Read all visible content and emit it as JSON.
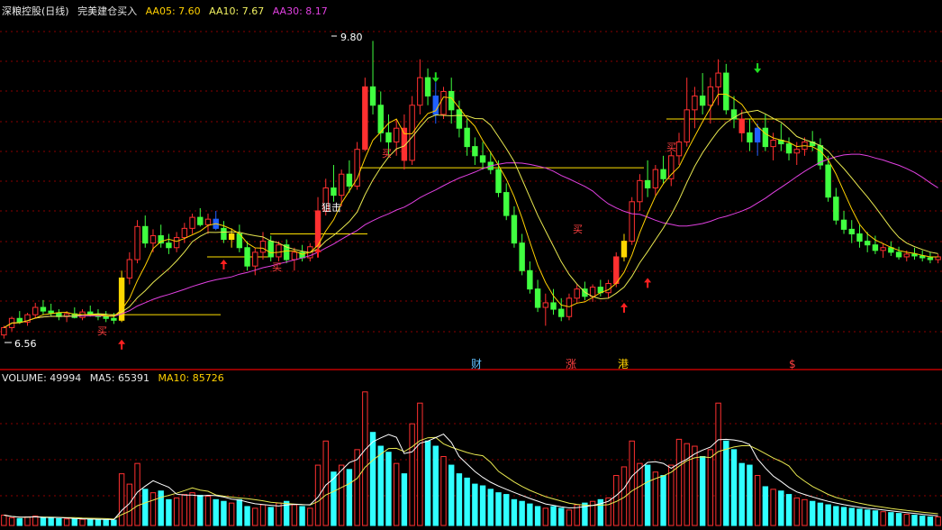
{
  "header": {
    "stock_name": "深粮控股(日线)",
    "indicator_name": "完美建仓买入",
    "aa05_label": "AA05: 7.60",
    "aa10_label": "AA10: 7.67",
    "aa30_label": "AA30: 8.17"
  },
  "volume_header": {
    "volume_label": "VOLUME: 49994",
    "ma5_label": "MA5: 65391",
    "ma10_label": "MA10: 85726"
  },
  "colors": {
    "up": "#ff3030",
    "down": "#30ffff",
    "down_candle": "#40ff40",
    "ma5": "#ffd000",
    "ma10": "#e8e850",
    "ma30": "#e040e0",
    "signal_yellow": "#ffd700",
    "signal_blue": "#2060ff"
  },
  "annotations": {
    "price_high": "9.80",
    "price_low": "6.56",
    "buy_text": "买",
    "sniper_text": "狙击",
    "event_cai": "财",
    "event_zhang": "涨",
    "event_gang": "港",
    "event_dollar": "$"
  },
  "chart_data": [
    {
      "type": "candlestick",
      "title": "深粮控股(日线)",
      "ylim": [
        6.4,
        10.0
      ],
      "ohlc": [
        [
          6.6,
          6.7,
          6.56,
          6.68
        ],
        [
          6.68,
          6.8,
          6.64,
          6.78
        ],
        [
          6.78,
          6.86,
          6.72,
          6.74
        ],
        [
          6.74,
          6.84,
          6.7,
          6.82
        ],
        [
          6.82,
          6.95,
          6.78,
          6.9
        ],
        [
          6.9,
          6.98,
          6.82,
          6.86
        ],
        [
          6.86,
          6.94,
          6.8,
          6.84
        ],
        [
          6.84,
          6.88,
          6.76,
          6.8
        ],
        [
          6.8,
          6.86,
          6.74,
          6.83
        ],
        [
          6.83,
          6.9,
          6.78,
          6.79
        ],
        [
          6.79,
          6.88,
          6.76,
          6.85
        ],
        [
          6.85,
          6.92,
          6.8,
          6.82
        ],
        [
          6.82,
          6.88,
          6.76,
          6.8
        ],
        [
          6.8,
          6.86,
          6.74,
          6.78
        ],
        [
          6.78,
          6.84,
          6.72,
          6.76
        ],
        [
          6.76,
          7.3,
          6.74,
          7.22
        ],
        [
          7.22,
          7.5,
          7.15,
          7.42
        ],
        [
          7.42,
          7.85,
          7.38,
          7.78
        ],
        [
          7.78,
          7.9,
          7.55,
          7.6
        ],
        [
          7.6,
          7.75,
          7.5,
          7.68
        ],
        [
          7.68,
          7.8,
          7.55,
          7.6
        ],
        [
          7.6,
          7.7,
          7.48,
          7.55
        ],
        [
          7.55,
          7.72,
          7.5,
          7.66
        ],
        [
          7.66,
          7.82,
          7.6,
          7.76
        ],
        [
          7.76,
          7.92,
          7.7,
          7.88
        ],
        [
          7.88,
          7.98,
          7.78,
          7.8
        ],
        [
          7.8,
          7.92,
          7.7,
          7.86
        ],
        [
          7.86,
          7.95,
          7.74,
          7.76
        ],
        [
          7.76,
          7.84,
          7.6,
          7.64
        ],
        [
          7.64,
          7.76,
          7.55,
          7.7
        ],
        [
          7.7,
          7.8,
          7.5,
          7.55
        ],
        [
          7.55,
          7.62,
          7.3,
          7.35
        ],
        [
          7.35,
          7.55,
          7.25,
          7.5
        ],
        [
          7.5,
          7.72,
          7.42,
          7.62
        ],
        [
          7.62,
          7.68,
          7.4,
          7.45
        ],
        [
          7.45,
          7.62,
          7.4,
          7.58
        ],
        [
          7.58,
          7.64,
          7.38,
          7.42
        ],
        [
          7.42,
          7.55,
          7.3,
          7.5
        ],
        [
          7.5,
          7.58,
          7.4,
          7.44
        ],
        [
          7.44,
          7.6,
          7.4,
          7.56
        ],
        [
          7.56,
          8.1,
          7.52,
          7.95
        ],
        [
          7.95,
          8.3,
          7.9,
          8.2
        ],
        [
          8.2,
          8.45,
          8.05,
          8.12
        ],
        [
          8.12,
          8.4,
          8.0,
          8.35
        ],
        [
          8.35,
          8.5,
          8.15,
          8.22
        ],
        [
          8.22,
          8.7,
          8.18,
          8.62
        ],
        [
          8.62,
          9.4,
          8.6,
          9.3
        ],
        [
          9.3,
          9.8,
          9.0,
          9.1
        ],
        [
          9.1,
          9.25,
          8.7,
          8.8
        ],
        [
          8.8,
          9.0,
          8.55,
          8.7
        ],
        [
          8.7,
          8.95,
          8.55,
          8.85
        ],
        [
          8.85,
          9.0,
          8.4,
          8.5
        ],
        [
          8.5,
          9.2,
          8.45,
          9.1
        ],
        [
          9.1,
          9.6,
          9.0,
          9.4
        ],
        [
          9.4,
          9.5,
          9.1,
          9.2
        ],
        [
          9.2,
          9.35,
          8.9,
          9.0
        ],
        [
          9.0,
          9.3,
          8.95,
          9.25
        ],
        [
          9.25,
          9.4,
          8.9,
          9.05
        ],
        [
          9.05,
          9.15,
          8.75,
          8.85
        ],
        [
          8.85,
          8.95,
          8.55,
          8.65
        ],
        [
          8.65,
          8.75,
          8.45,
          8.55
        ],
        [
          8.55,
          8.7,
          8.4,
          8.48
        ],
        [
          8.48,
          8.6,
          8.35,
          8.4
        ],
        [
          8.4,
          8.5,
          8.1,
          8.15
        ],
        [
          8.15,
          8.25,
          7.85,
          7.9
        ],
        [
          7.9,
          8.0,
          7.55,
          7.6
        ],
        [
          7.6,
          7.7,
          7.25,
          7.3
        ],
        [
          7.3,
          7.4,
          7.05,
          7.1
        ],
        [
          7.1,
          7.2,
          6.85,
          6.9
        ],
        [
          6.9,
          7.05,
          6.7,
          6.95
        ],
        [
          6.95,
          7.1,
          6.82,
          6.88
        ],
        [
          6.88,
          7.0,
          6.75,
          6.8
        ],
        [
          6.8,
          7.05,
          6.76,
          7.0
        ],
        [
          7.0,
          7.15,
          6.95,
          7.1
        ],
        [
          7.1,
          7.18,
          6.98,
          7.02
        ],
        [
          7.02,
          7.15,
          6.96,
          7.12
        ],
        [
          7.12,
          7.2,
          7.02,
          7.06
        ],
        [
          7.06,
          7.2,
          7.0,
          7.16
        ],
        [
          7.16,
          7.5,
          7.12,
          7.45
        ],
        [
          7.45,
          7.7,
          7.4,
          7.62
        ],
        [
          7.62,
          8.1,
          7.58,
          8.05
        ],
        [
          8.05,
          8.35,
          7.95,
          8.28
        ],
        [
          8.28,
          8.5,
          8.1,
          8.2
        ],
        [
          8.2,
          8.45,
          8.12,
          8.4
        ],
        [
          8.4,
          8.55,
          8.25,
          8.3
        ],
        [
          8.3,
          8.6,
          8.22,
          8.55
        ],
        [
          8.55,
          8.8,
          8.45,
          8.7
        ],
        [
          8.7,
          9.4,
          8.65,
          9.05
        ],
        [
          9.05,
          9.3,
          8.85,
          9.2
        ],
        [
          9.2,
          9.45,
          9.0,
          9.1
        ],
        [
          9.1,
          9.4,
          8.9,
          9.3
        ],
        [
          9.3,
          9.6,
          9.1,
          9.45
        ],
        [
          9.45,
          9.55,
          9.0,
          9.05
        ],
        [
          9.05,
          9.2,
          8.85,
          8.95
        ],
        [
          8.95,
          9.05,
          8.7,
          8.8
        ],
        [
          8.8,
          8.95,
          8.6,
          8.7
        ],
        [
          8.7,
          8.9,
          8.55,
          8.85
        ],
        [
          8.85,
          9.0,
          8.6,
          8.65
        ],
        [
          8.65,
          8.8,
          8.5,
          8.72
        ],
        [
          8.72,
          8.9,
          8.6,
          8.68
        ],
        [
          8.68,
          8.75,
          8.5,
          8.58
        ],
        [
          8.58,
          8.7,
          8.45,
          8.62
        ],
        [
          8.62,
          8.75,
          8.55,
          8.7
        ],
        [
          8.7,
          8.82,
          8.6,
          8.66
        ],
        [
          8.66,
          8.74,
          8.4,
          8.45
        ],
        [
          8.45,
          8.55,
          8.05,
          8.1
        ],
        [
          8.1,
          8.2,
          7.8,
          7.85
        ],
        [
          7.85,
          7.95,
          7.7,
          7.75
        ],
        [
          7.75,
          7.85,
          7.6,
          7.7
        ],
        [
          7.7,
          7.8,
          7.55,
          7.62
        ],
        [
          7.62,
          7.72,
          7.5,
          7.58
        ],
        [
          7.58,
          7.68,
          7.48,
          7.52
        ],
        [
          7.52,
          7.6,
          7.44,
          7.55
        ],
        [
          7.55,
          7.62,
          7.46,
          7.5
        ],
        [
          7.5,
          7.56,
          7.42,
          7.45
        ],
        [
          7.45,
          7.52,
          7.4,
          7.48
        ],
        [
          7.48,
          7.55,
          7.42,
          7.46
        ],
        [
          7.46,
          7.52,
          7.4,
          7.44
        ],
        [
          7.44,
          7.5,
          7.38,
          7.42
        ],
        [
          7.42,
          7.48,
          7.38,
          7.45
        ]
      ],
      "ma5_label": "AA05",
      "ma10_label": "AA10",
      "ma30_label": "AA30"
    },
    {
      "type": "bar",
      "title": "VOLUME",
      "ylim": [
        0,
        160000
      ],
      "values": [
        12000,
        9000,
        8000,
        10000,
        11000,
        9000,
        8500,
        8000,
        7600,
        7400,
        7200,
        7000,
        6800,
        6500,
        6300,
        60000,
        48000,
        72000,
        42000,
        38000,
        40000,
        30000,
        32000,
        36000,
        38000,
        35000,
        34000,
        30000,
        28000,
        26000,
        30000,
        22000,
        20000,
        24000,
        21000,
        26000,
        28000,
        24000,
        22000,
        20000,
        70000,
        98000,
        62000,
        70000,
        65000,
        88000,
        155000,
        108000,
        92000,
        85000,
        72000,
        60000,
        118000,
        142000,
        98000,
        92000,
        80000,
        70000,
        60000,
        55000,
        48000,
        46000,
        42000,
        38000,
        36000,
        30000,
        28000,
        25000,
        22000,
        20000,
        22000,
        20000,
        18000,
        24000,
        26000,
        28000,
        30000,
        32000,
        58000,
        68000,
        98000,
        72000,
        70000,
        62000,
        58000,
        70000,
        100000,
        95000,
        92000,
        80000,
        88000,
        142000,
        98000,
        88000,
        72000,
        70000,
        58000,
        45000,
        42000,
        40000,
        36000,
        32000,
        30000,
        28000,
        26000,
        24000,
        22000,
        21000,
        20000,
        19000,
        18000,
        17000,
        16000,
        15000,
        14000,
        13000,
        12000,
        11000,
        10000,
        10000
      ],
      "ma5_label": "MA5",
      "ma10_label": "MA10"
    }
  ]
}
